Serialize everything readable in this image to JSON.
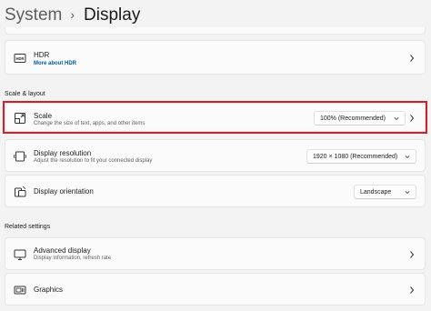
{
  "breadcrumb": {
    "parent": "System",
    "separator": "›",
    "current": "Display"
  },
  "hdr": {
    "title": "HDR",
    "link": "More about HDR",
    "icon": "hdr-icon"
  },
  "scale_layout_section": {
    "label": "Scale & layout"
  },
  "scale": {
    "title": "Scale",
    "description": "Change the size of text, apps, and other items",
    "value": "100% (Recommended)",
    "icon": "scale-icon"
  },
  "resolution": {
    "title": "Display resolution",
    "description": "Adjust the resolution to fit your connected display",
    "value": "1920 × 1080 (Recommended)",
    "icon": "resolution-icon"
  },
  "orientation": {
    "title": "Display orientation",
    "value": "Landscape",
    "icon": "orientation-icon"
  },
  "related_section": {
    "label": "Related settings"
  },
  "advanced": {
    "title": "Advanced display",
    "description": "Display information, refresh rate",
    "icon": "monitor-icon"
  },
  "graphics": {
    "title": "Graphics",
    "icon": "graphics-icon"
  },
  "colors": {
    "highlight": "#d1202b",
    "link": "#005a9e",
    "background": "#f3f3f3",
    "card": "#fbfbfb"
  }
}
